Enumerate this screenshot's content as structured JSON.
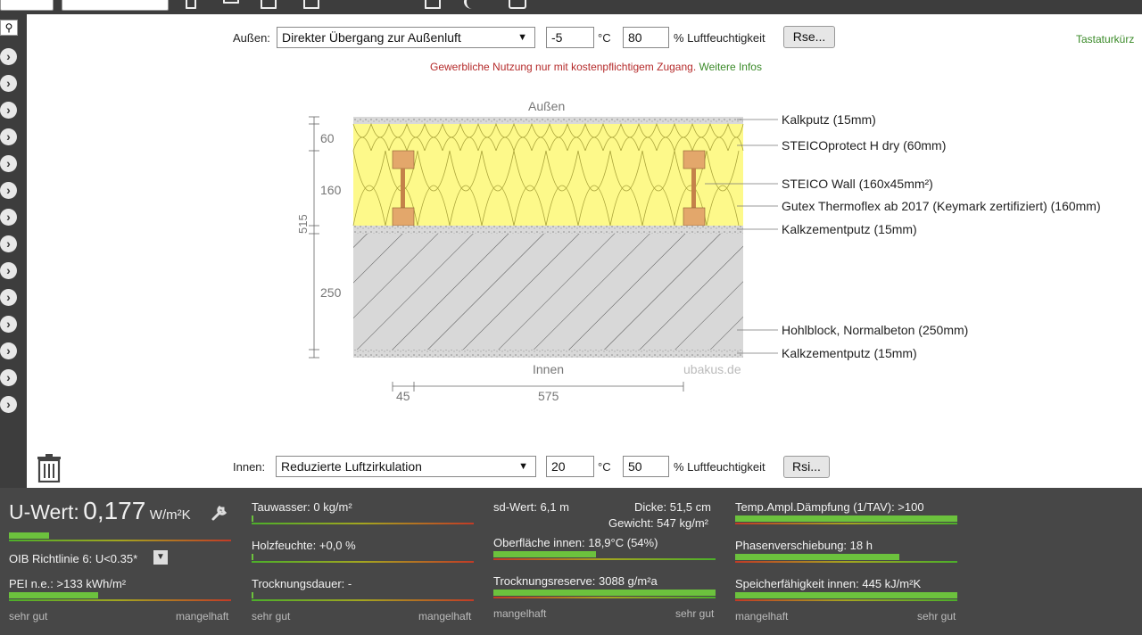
{
  "top": {
    "box1": "",
    "box2": ""
  },
  "outside": {
    "label": "Außen:",
    "select": "Direkter Übergang zur Außenluft",
    "temp": "-5",
    "temp_unit": "°C",
    "humidity": "80",
    "humidity_unit": "% Luftfeuchtigkeit",
    "rse_button": "Rse..."
  },
  "notice": {
    "text": "Gewerbliche Nutzung nur mit kostenpflichtigem Zugang.",
    "link": "Weitere Infos"
  },
  "shortcut_link": "Tastaturkürz",
  "diagram": {
    "top_label": "Außen",
    "bottom_label": "Innen",
    "watermark": "ubakus.de",
    "dims": {
      "d60": "60",
      "d160": "160",
      "d515": "515",
      "d250": "250",
      "d45": "45",
      "d575": "575"
    },
    "layers": [
      {
        "name": "Kalkputz (15mm)"
      },
      {
        "name": "STEICOprotect H dry (60mm)"
      },
      {
        "name": "STEICO  Wall (160x45mm²)"
      },
      {
        "name": "Gutex Thermoflex ab 2017 (Keymark zertifiziert) (160mm)"
      },
      {
        "name": "Kalkzementputz (15mm)"
      },
      {
        "name": "Hohlblock, Normalbeton (250mm)"
      },
      {
        "name": "Kalkzementputz (15mm)"
      }
    ]
  },
  "inside": {
    "label": "Innen:",
    "select": "Reduzierte Luftzirkulation",
    "temp": "20",
    "temp_unit": "°C",
    "humidity": "50",
    "humidity_unit": "% Luftfeuchtigkeit",
    "rsi_button": "Rsi..."
  },
  "results": {
    "u_label": "U-Wert:",
    "u_value": "0,177",
    "u_unit": "W/m²K",
    "u_fill": 0.18,
    "oib": "OIB Richtlinie 6: U<0.35*",
    "pei": "PEI n.e.: >133 kWh/m²",
    "pei_fill": 0.4,
    "tauwasser": "Tauwasser: 0 kg/m²",
    "tauwasser_fill": 0.0,
    "holzfeuchte": "Holzfeuchte: +0,0 %",
    "holzfeuchte_fill": 0.0,
    "trocknungsdauer": "Trocknungsdauer: -",
    "trocknungsdauer_fill": 0.0,
    "sd": "sd-Wert: 6,1 m",
    "dicke": "Dicke: 51,5 cm",
    "gewicht": "Gewicht: 547 kg/m²",
    "oberflaeche": "Oberfläche innen: 18,9°C (54%)",
    "oberflaeche_fill": 0.46,
    "trocknungsreserve": "Trocknungsreserve: 3088 g/m²a",
    "trocknungsreserve_fill": 1.0,
    "temp_amp": "Temp.Ampl.Dämpfung (1/TAV): >100",
    "temp_amp_fill": 1.0,
    "phasen": "Phasenverschiebung: 18 h",
    "phasen_fill": 0.74,
    "speicher": "Speicherfähigkeit innen: 445 kJ/m²K",
    "speicher_fill": 1.0,
    "scale_good": "sehr gut",
    "scale_bad": "mangelhaft"
  }
}
